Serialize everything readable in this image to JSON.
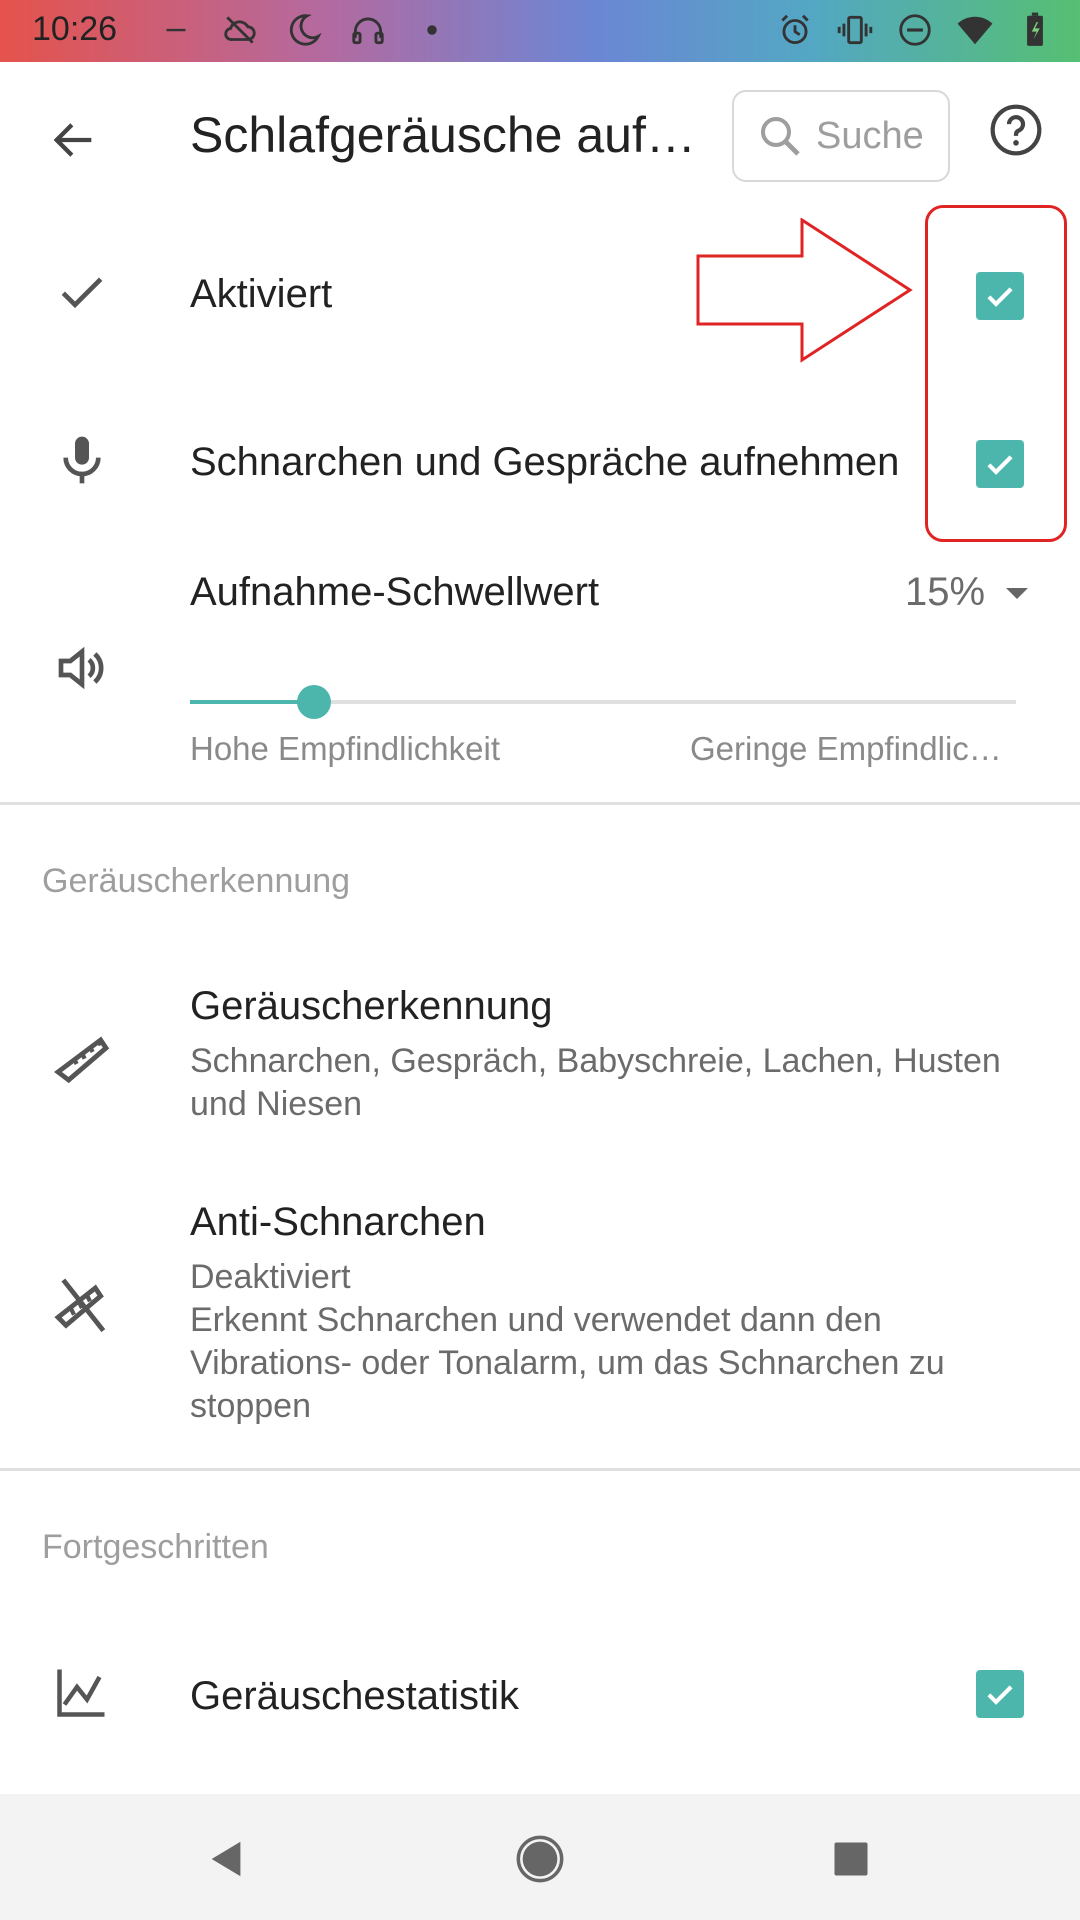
{
  "status_bar": {
    "time": "10:26",
    "left_icons": [
      "minus-icon",
      "cloud-off-icon",
      "moon-icon",
      "headphones-icon",
      "dot-icon"
    ],
    "right_icons": [
      "alarm-icon",
      "vibrate-icon",
      "do-not-disturb-icon",
      "wifi-icon",
      "battery-charging-icon"
    ]
  },
  "toolbar": {
    "title": "Schlafgeräusche aufnehmen",
    "search_placeholder": "Suche"
  },
  "settings": {
    "activated": {
      "label": "Aktiviert",
      "checked": true
    },
    "record": {
      "label": "Schnarchen und Gespräche aufnehmen",
      "checked": true
    },
    "threshold": {
      "label": "Aufnahme-Schwellwert",
      "value": "15%",
      "slider_value": 0.15,
      "min_label": "Hohe Empfindlichkeit",
      "max_label": "Geringe Empfindlichkeit"
    }
  },
  "section_noise": {
    "header": "Geräuscherkennung",
    "items": [
      {
        "title": "Geräuscherkennung",
        "subtitle": "Schnarchen, Gespräch, Babyschreie, Lachen, Husten und Niesen"
      },
      {
        "title": "Anti-Schnarchen",
        "status": "Deaktiviert",
        "subtitle": "Erkennt Schnarchen und verwendet dann den Vibrations- oder Tonalarm, um das Schnarchen zu stoppen"
      }
    ]
  },
  "section_advanced": {
    "header": "Fortgeschritten",
    "items": [
      {
        "title": "Geräuschestatistik",
        "checked": true
      }
    ]
  },
  "colors": {
    "accent": "#4db6ac",
    "annotation": "#e02424"
  }
}
